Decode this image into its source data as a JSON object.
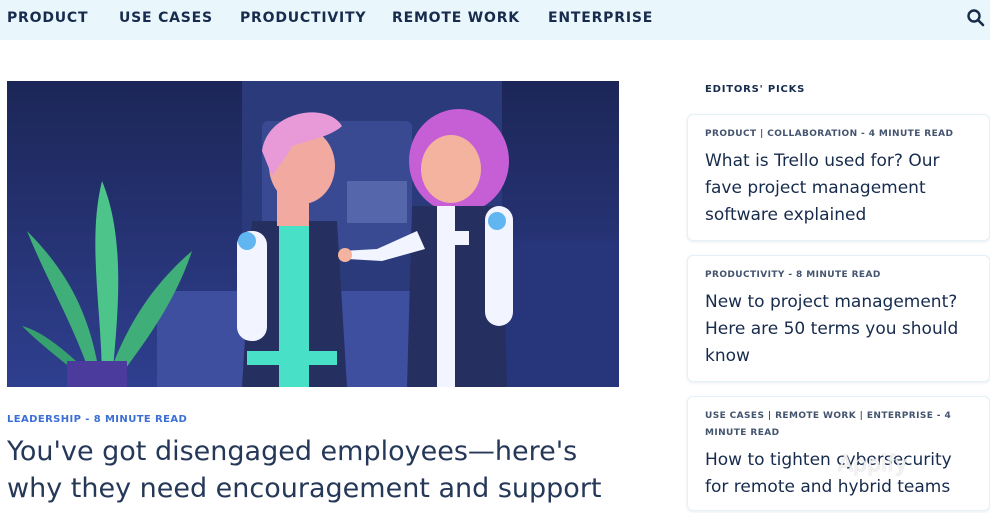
{
  "nav": {
    "items": [
      "PRODUCT",
      "USE CASES",
      "PRODUCTIVITY",
      "REMOTE WORK",
      "ENTERPRISE"
    ],
    "search_icon": "search-icon"
  },
  "feature": {
    "category": "LEADERSHIP - 8 MINUTE READ",
    "title": "You've got disengaged employees—here's why they need encouragement and support"
  },
  "editors_picks": {
    "heading": "EDITORS' PICKS",
    "cards": [
      {
        "category": "PRODUCT | COLLABORATION - 4 MINUTE READ",
        "title": "What is Trello used for? Our fave project management software explained"
      },
      {
        "category": "PRODUCTIVITY - 8 MINUTE READ",
        "title": "New to project management? Here are 50 terms you should know"
      },
      {
        "category": "USE CASES | REMOTE WORK | ENTERPRISE - 4 MINUTE READ",
        "title": "How to tighten cybersecurity for remote and hybrid teams"
      }
    ]
  },
  "watermark": "Appify",
  "colors": {
    "nav_bg": "#e9f6fb",
    "text": "#172b4d",
    "accent": "#3b6fd6",
    "hero_bg": "#1e2a5c"
  }
}
